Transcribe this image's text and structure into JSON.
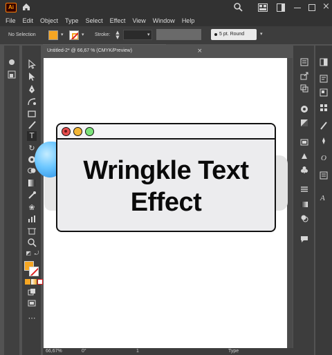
{
  "app": {
    "logo_text": "Ai",
    "accent": "#ff9a00"
  },
  "menu": [
    "File",
    "Edit",
    "Object",
    "Type",
    "Select",
    "Effect",
    "View",
    "Window",
    "Help"
  ],
  "control_bar": {
    "selection_label": "No Selection",
    "fill_color": "#f5a623",
    "stroke_label": "Stroke:",
    "brush_label": "5 pt. Round"
  },
  "document": {
    "tab_title": "Untitled-2* @ 66,67 % (CMYK/Preview)",
    "close_glyph": "×"
  },
  "artwork": {
    "title_line1": "Wringkle Text",
    "title_line2": "Effect",
    "dot_colors": [
      "#e54d4d",
      "#f2b636",
      "#7be27a"
    ]
  },
  "status_bar": {
    "zoom": "66,67%",
    "rotation": "0°",
    "artboard": "1",
    "tool": "Type"
  },
  "icons": {
    "left_toolbar": [
      "selection-icon",
      "direct-selection-icon",
      "pen-icon",
      "curvature-icon",
      "rectangle-icon",
      "brush-icon",
      "type-icon",
      "rotate-icon",
      "warp-icon",
      "shape-builder-icon",
      "gradient-icon",
      "eyedropper-icon",
      "symbol-sprayer-icon",
      "column-graph-icon",
      "artboard-icon",
      "zoom-icon"
    ]
  }
}
